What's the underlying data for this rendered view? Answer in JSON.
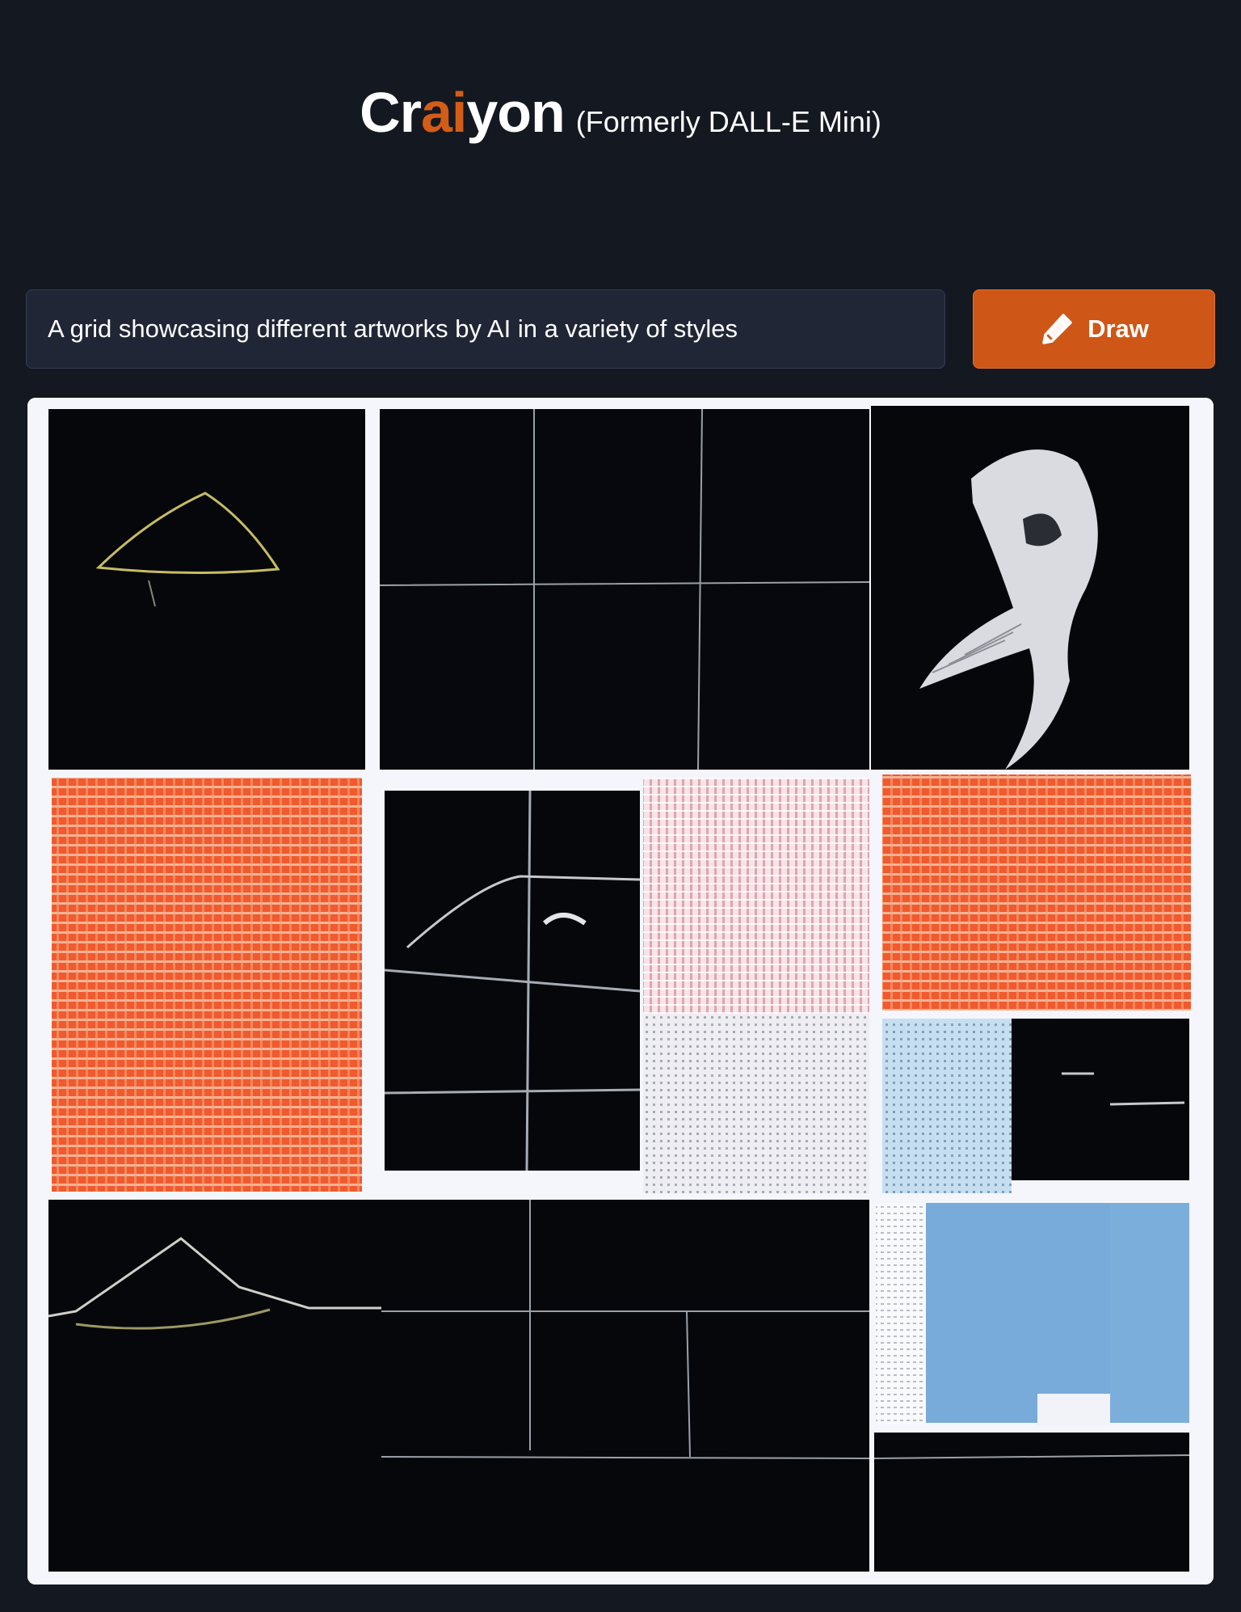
{
  "header": {
    "logo_part1": "Cr",
    "logo_part2": "ai",
    "logo_part3": "yon",
    "subtitle": "(Formerly DALL-E Mini)"
  },
  "prompt": {
    "value": "A grid showcasing different artworks by AI in a variety of styles"
  },
  "draw_button": {
    "label": "Draw",
    "icon": "pencil-icon"
  },
  "result": {
    "description_icon": "generated-artwork-grid-image"
  },
  "colors": {
    "background": "#141821",
    "accent": "#ce5616",
    "input_bg": "#212636",
    "text": "#ffffff"
  }
}
